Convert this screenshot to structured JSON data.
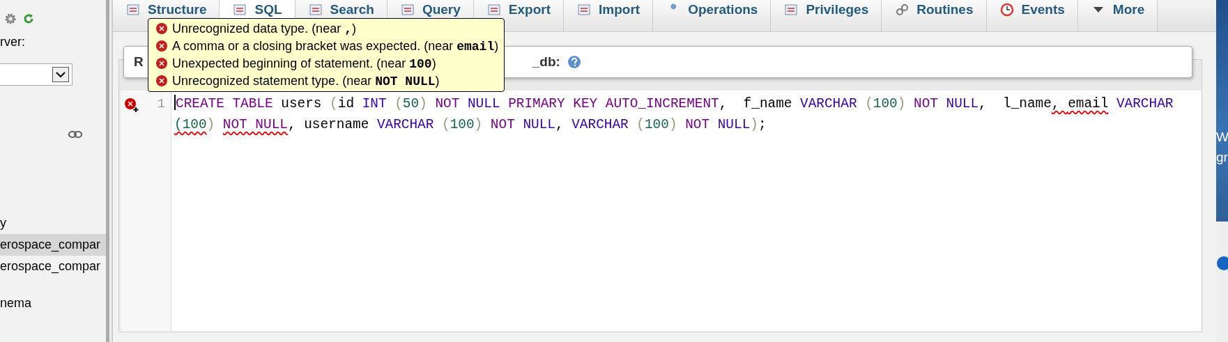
{
  "sidebar": {
    "label": "rver:",
    "tree_items": [
      {
        "label": "y",
        "selected": false
      },
      {
        "label": "erospace_compar",
        "selected": true
      },
      {
        "label": "erospace_compar",
        "selected": false
      },
      {
        "label": "nema",
        "selected": false
      }
    ]
  },
  "tabs": [
    {
      "label": "Structure",
      "selected": false
    },
    {
      "label": "SQL",
      "selected": true
    },
    {
      "label": "Search",
      "selected": false
    },
    {
      "label": "Query",
      "selected": false
    },
    {
      "label": "Export",
      "selected": false
    },
    {
      "label": "Import",
      "selected": false
    },
    {
      "label": "Operations",
      "selected": false
    },
    {
      "label": "Privileges",
      "selected": false
    },
    {
      "label": "Routines",
      "selected": false
    },
    {
      "label": "Events",
      "selected": false
    },
    {
      "label": "More",
      "selected": false
    }
  ],
  "query_box": {
    "legend_start": "R",
    "legend_end": "_db:"
  },
  "editor": {
    "line_number": "1",
    "tokens": [
      {
        "text": "CREATE TABLE",
        "kind": "keyword",
        "error": false
      },
      {
        "text": " users ",
        "kind": "plain",
        "error": false
      },
      {
        "text": "(",
        "kind": "bracket",
        "error": false
      },
      {
        "text": "id ",
        "kind": "plain",
        "error": false
      },
      {
        "text": "INT ",
        "kind": "type",
        "error": false
      },
      {
        "text": "(",
        "kind": "bracket",
        "error": false
      },
      {
        "text": "50",
        "kind": "number",
        "error": false
      },
      {
        "text": ") ",
        "kind": "bracket",
        "error": false
      },
      {
        "text": "NOT ",
        "kind": "keyword",
        "error": false
      },
      {
        "text": "NULL ",
        "kind": "type",
        "error": false
      },
      {
        "text": "PRIMARY KEY AUTO_INCREMENT",
        "kind": "keyword",
        "error": false
      },
      {
        "text": ",  f_name ",
        "kind": "plain",
        "error": false
      },
      {
        "text": "VARCHAR ",
        "kind": "type",
        "error": false
      },
      {
        "text": "(",
        "kind": "bracket",
        "error": false
      },
      {
        "text": "100",
        "kind": "number",
        "error": false
      },
      {
        "text": ") ",
        "kind": "bracket",
        "error": false
      },
      {
        "text": "NOT ",
        "kind": "keyword",
        "error": false
      },
      {
        "text": "NULL",
        "kind": "type",
        "error": false
      },
      {
        "text": ",  l_name",
        "kind": "plain",
        "error": false
      },
      {
        "text": ", ",
        "kind": "plain",
        "error": true
      },
      {
        "text": "email",
        "kind": "plain",
        "error": true
      },
      {
        "text": " VARCHAR ",
        "kind": "type",
        "error": false
      },
      {
        "text": "(100",
        "kind": "number",
        "error": true
      },
      {
        "text": ") ",
        "kind": "bracket",
        "error": false
      },
      {
        "text": "NOT NULL",
        "kind": "keyword",
        "error": true
      },
      {
        "text": ", username ",
        "kind": "plain",
        "error": false
      },
      {
        "text": "VARCHAR ",
        "kind": "type",
        "error": false
      },
      {
        "text": "(",
        "kind": "bracket",
        "error": false
      },
      {
        "text": "100",
        "kind": "number",
        "error": false
      },
      {
        "text": ") ",
        "kind": "bracket",
        "error": false
      },
      {
        "text": "NOT ",
        "kind": "keyword",
        "error": false
      },
      {
        "text": "NULL",
        "kind": "type",
        "error": false
      },
      {
        "text": ", ",
        "kind": "plain",
        "error": false
      },
      {
        "text": "VARCHAR ",
        "kind": "type",
        "error": false
      },
      {
        "text": "(",
        "kind": "bracket",
        "error": false
      },
      {
        "text": "100",
        "kind": "number",
        "error": false
      },
      {
        "text": ") ",
        "kind": "bracket",
        "error": false
      },
      {
        "text": "NOT ",
        "kind": "keyword",
        "error": false
      },
      {
        "text": "NULL",
        "kind": "type",
        "error": false
      },
      {
        "text": ")",
        "kind": "bracket",
        "error": false
      },
      {
        "text": ";",
        "kind": "plain",
        "error": false
      }
    ]
  },
  "tooltip": {
    "errors": [
      {
        "text": "Unrecognized data type. (near",
        "token": ",",
        "end": ")"
      },
      {
        "text": "A comma or a closing bracket was expected. (near",
        "token": "email",
        "end": ")"
      },
      {
        "text": "Unexpected beginning of statement. (near",
        "token": "100",
        "end": ")"
      },
      {
        "text": "Unrecognized statement type. (near",
        "token": "NOT NULL",
        "end": ")"
      }
    ]
  },
  "desktop": {
    "texts": [
      "W",
      "gr"
    ]
  }
}
